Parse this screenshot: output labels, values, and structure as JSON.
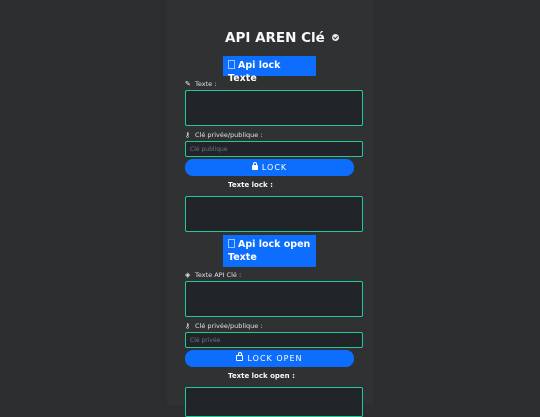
{
  "page": {
    "title": "API AREN Clé",
    "lock_section": {
      "api_button": "Api lock Texte",
      "text_label": "Texte :",
      "key_label": "Clé privée/publique :",
      "key_placeholder": "Clé publique",
      "action_button": "LOCK",
      "result_label": "Texte lock :"
    },
    "open_section": {
      "api_button_line1": "Api lock open",
      "api_button_line2": "Texte",
      "text_label": "Texte API Clé :",
      "key_label": "Clé privée/publique :",
      "key_placeholder": "Clé privée",
      "action_button": "LOCK OPEN",
      "result_label": "Texte lock open :"
    }
  },
  "colors": {
    "background": "#2b2d2f",
    "panel": "#2f3133",
    "field_border": "#20c997",
    "field_bg": "#212529",
    "accent": "#0d6efd"
  },
  "icons": [
    "check-circle-icon",
    "pencil-icon",
    "key-icon",
    "lock-icon",
    "shield-icon",
    "unlock-icon"
  ]
}
